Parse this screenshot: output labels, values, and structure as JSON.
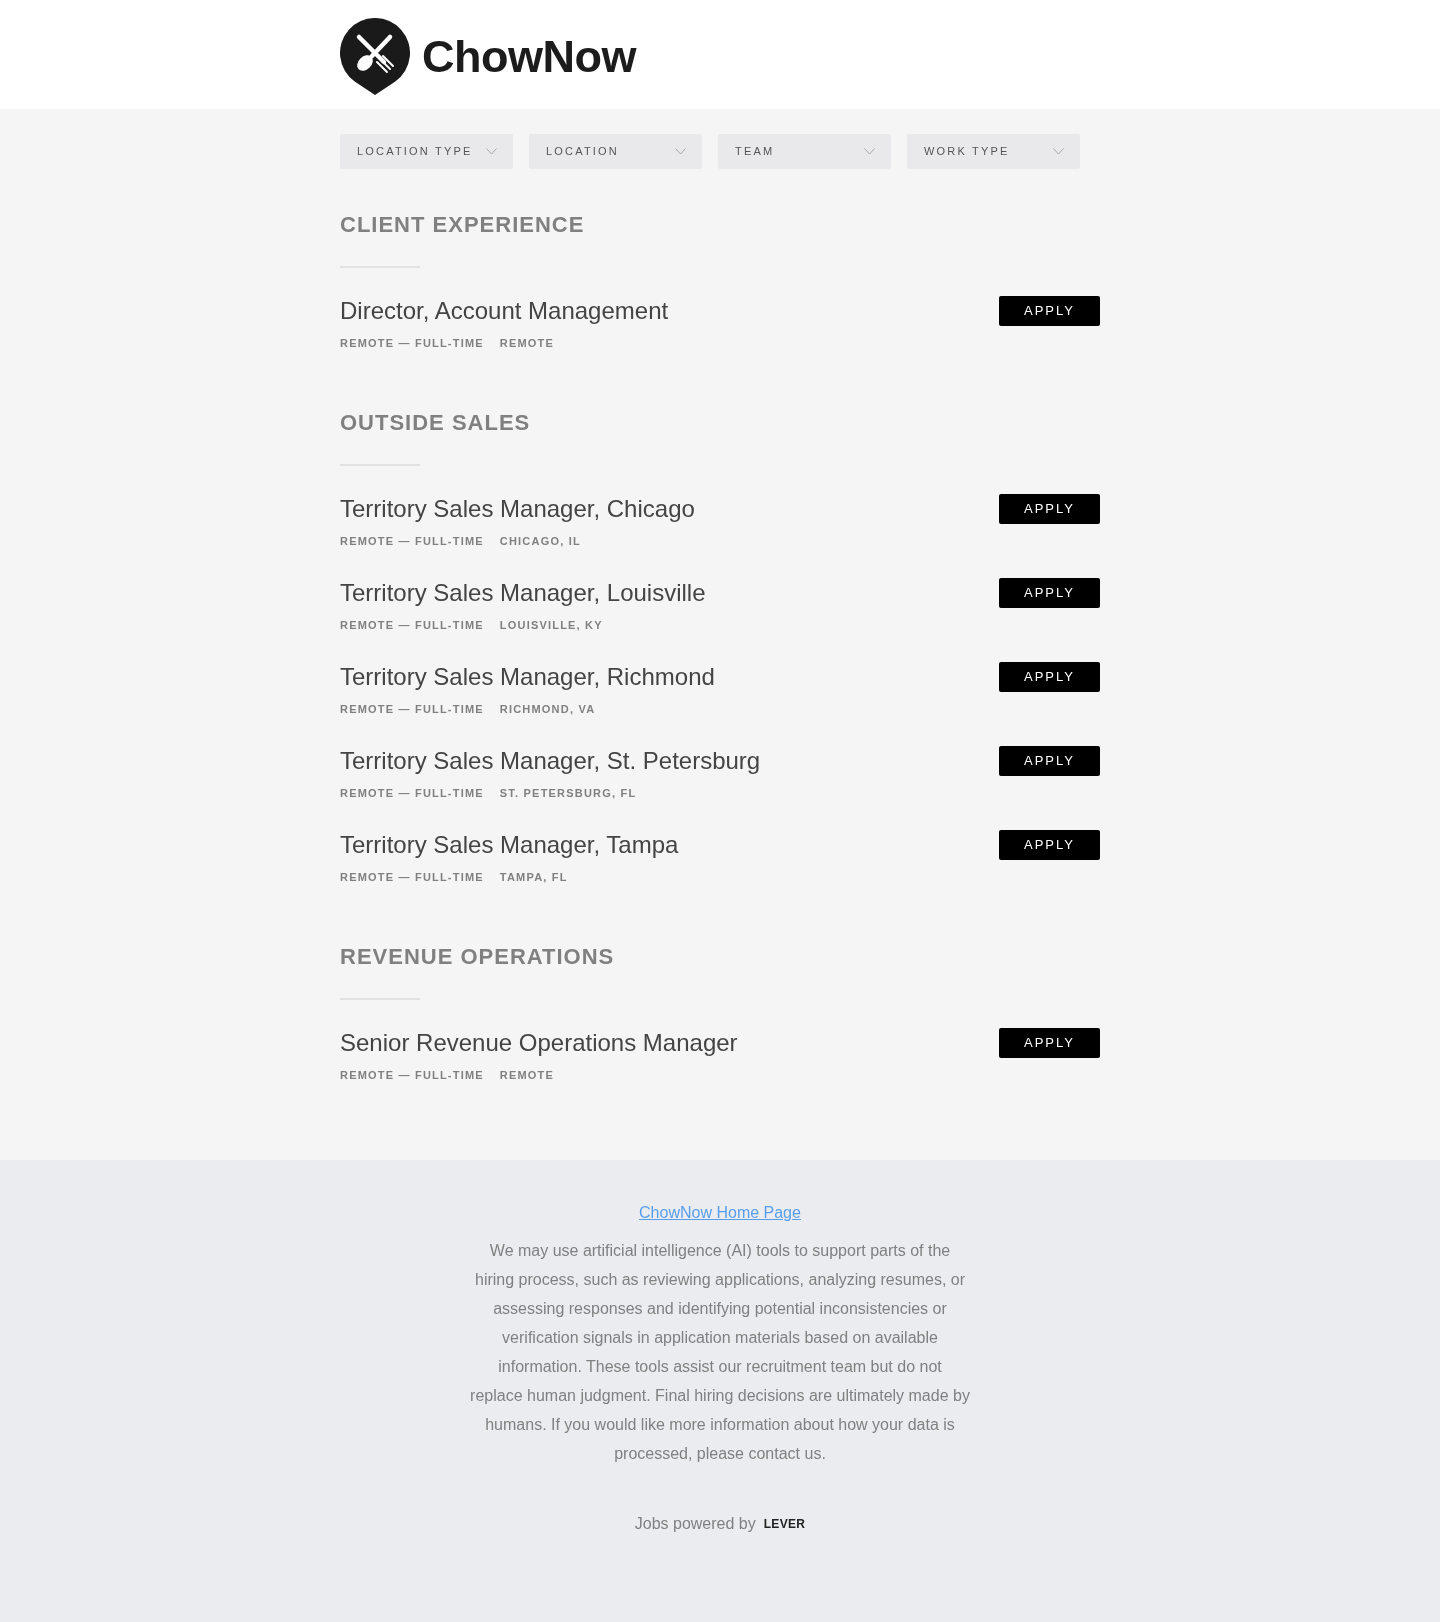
{
  "header": {
    "logo_text": "ChowNow"
  },
  "filters": [
    {
      "label": "LOCATION TYPE"
    },
    {
      "label": "LOCATION"
    },
    {
      "label": "TEAM"
    },
    {
      "label": "WORK TYPE"
    }
  ],
  "sections": [
    {
      "title": "CLIENT EXPERIENCE",
      "postings": [
        {
          "title": "Director, Account Management",
          "commitment": "REMOTE — FULL-TIME",
          "location": "REMOTE",
          "button": "APPLY"
        }
      ]
    },
    {
      "title": "OUTSIDE SALES",
      "postings": [
        {
          "title": "Territory Sales Manager, Chicago",
          "commitment": "REMOTE — FULL-TIME",
          "location": "CHICAGO, IL",
          "button": "APPLY"
        },
        {
          "title": "Territory Sales Manager, Louisville",
          "commitment": "REMOTE — FULL-TIME",
          "location": "LOUISVILLE, KY",
          "button": "APPLY"
        },
        {
          "title": "Territory Sales Manager, Richmond",
          "commitment": "REMOTE — FULL-TIME",
          "location": "RICHMOND, VA",
          "button": "APPLY"
        },
        {
          "title": "Territory Sales Manager, St. Petersburg",
          "commitment": "REMOTE — FULL-TIME",
          "location": "ST. PETERSBURG, FL",
          "button": "APPLY"
        },
        {
          "title": "Territory Sales Manager, Tampa",
          "commitment": "REMOTE — FULL-TIME",
          "location": "TAMPA, FL",
          "button": "APPLY"
        }
      ]
    },
    {
      "title": "REVENUE OPERATIONS",
      "postings": [
        {
          "title": "Senior Revenue Operations Manager",
          "commitment": "REMOTE — FULL-TIME",
          "location": "REMOTE",
          "button": "APPLY"
        }
      ]
    }
  ],
  "footer": {
    "link": "ChowNow Home Page",
    "notice": "We may use artificial intelligence (AI) tools to support parts of the hiring process, such as reviewing applications, analyzing resumes, or assessing responses and identifying potential inconsistencies or verification signals in application materials based on available information. These tools assist our recruitment team but do not replace human judgment. Final hiring decisions are ultimately made by humans. If you would like more information about how your data is processed, please contact us.",
    "powered_by": "Jobs powered by",
    "brand": "LEVER"
  }
}
